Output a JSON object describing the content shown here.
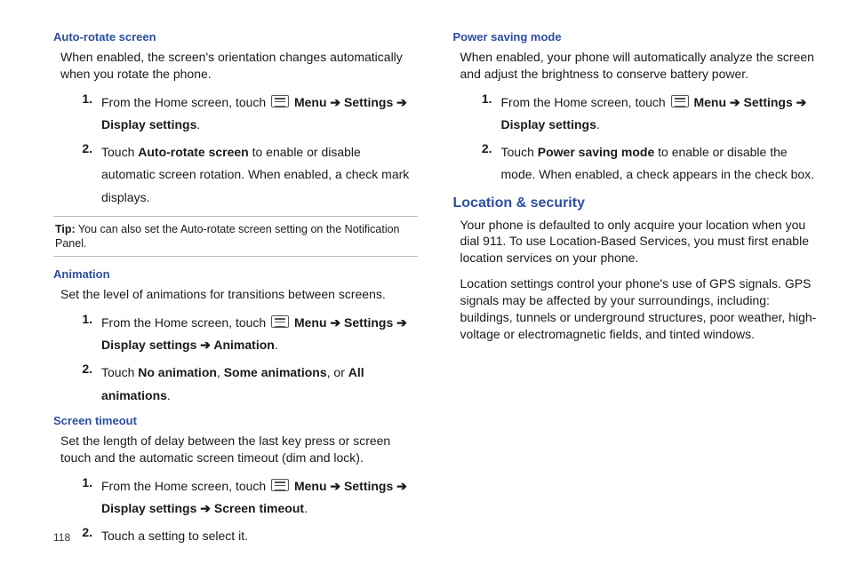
{
  "pageNumber": "118",
  "left": {
    "autoRotate": {
      "heading": "Auto-rotate screen",
      "intro": "When enabled, the screen's orientation changes automatically when you rotate the phone.",
      "step1_pre": "From the Home screen, touch ",
      "menu": "Menu",
      "arrow": " ➔ ",
      "settings": "Settings",
      "displaySettings": "Display settings",
      "period": ".",
      "step2_a": "Touch ",
      "step2_b": "Auto-rotate screen",
      "step2_c": " to enable or disable automatic screen rotation. When enabled, a check mark displays.",
      "tipLabel": "Tip:",
      "tipBody": " You can also set the Auto-rotate screen setting on the Notification Panel."
    },
    "animation": {
      "heading": "Animation",
      "intro": "Set the level of animations for transitions between screens.",
      "step1_pre": "From the Home screen, touch ",
      "dispAnim": "Display settings",
      "anim": "Animation",
      "step2_a": "Touch ",
      "noAnim": "No animation",
      "comma": ", ",
      "someAnim": "Some animations",
      "or": ", or ",
      "allAnim": "All animations"
    },
    "timeout": {
      "heading": "Screen timeout",
      "intro": "Set the length of delay between the last key press or screen touch and the automatic screen timeout (dim and lock).",
      "step1_pre": "From the Home screen, touch ",
      "screenTimeout": "Screen timeout",
      "step2": "Touch a setting to select it."
    }
  },
  "right": {
    "powerSave": {
      "heading": "Power saving mode",
      "intro": "When enabled, your phone will automatically analyze the screen and adjust the brightness to conserve battery power.",
      "step1_pre": "From the Home screen, touch ",
      "step2_a": "Touch ",
      "psm": "Power saving mode",
      "step2_c": " to enable or disable the mode. When enabled, a check appears in the check box."
    },
    "locSec": {
      "heading": "Location & security",
      "p1": "Your phone is defaulted to only acquire your location when you dial 911. To use Location-Based Services, you must first enable location services on your phone.",
      "p2": "Location settings control your phone's use of GPS signals. GPS signals may be affected by your surroundings, including: buildings, tunnels or underground structures, poor weather, high-voltage or electromagnetic fields, and tinted windows."
    }
  }
}
